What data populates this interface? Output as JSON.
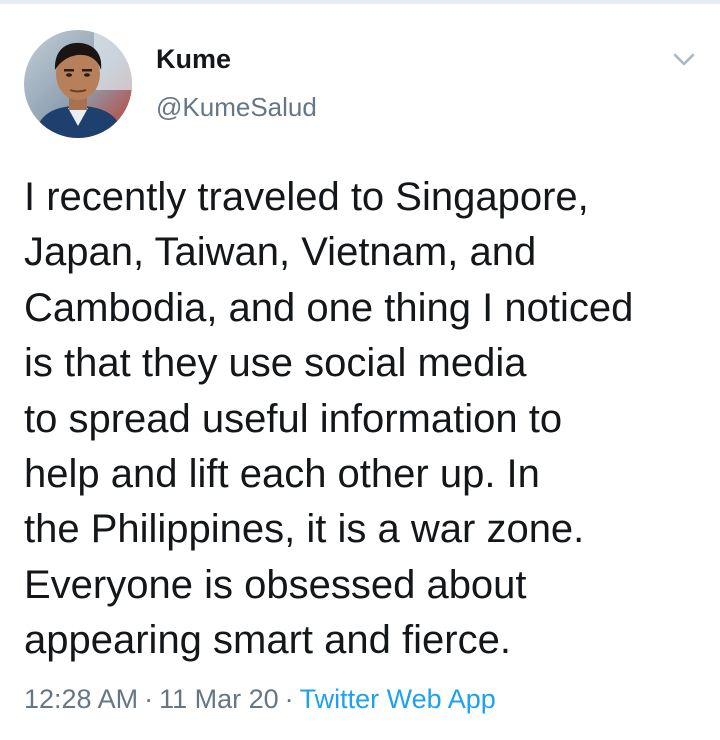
{
  "tweet": {
    "author": {
      "name": "Kume",
      "handle": "@KumeSalud",
      "avatar_icon": "profile-photo"
    },
    "menu_icon": "chevron-down-icon",
    "text_lines": [
      "I recently traveled to Singapore,",
      "Japan, Taiwan, Vietnam, and",
      "Cambodia, and one thing I noticed",
      "is that they use social media",
      "to spread useful information to",
      "help and lift each other up. In",
      "the Philippines, it is a war zone.",
      "Everyone is obsessed about",
      "appearing smart and fierce."
    ],
    "time": "12:28 AM",
    "separator": "·",
    "date": "11 Mar 20",
    "source": "Twitter Web App"
  },
  "colors": {
    "text": "#14171a",
    "secondary": "#657786",
    "link": "#1da1f2",
    "border": "#e6ecf0"
  }
}
